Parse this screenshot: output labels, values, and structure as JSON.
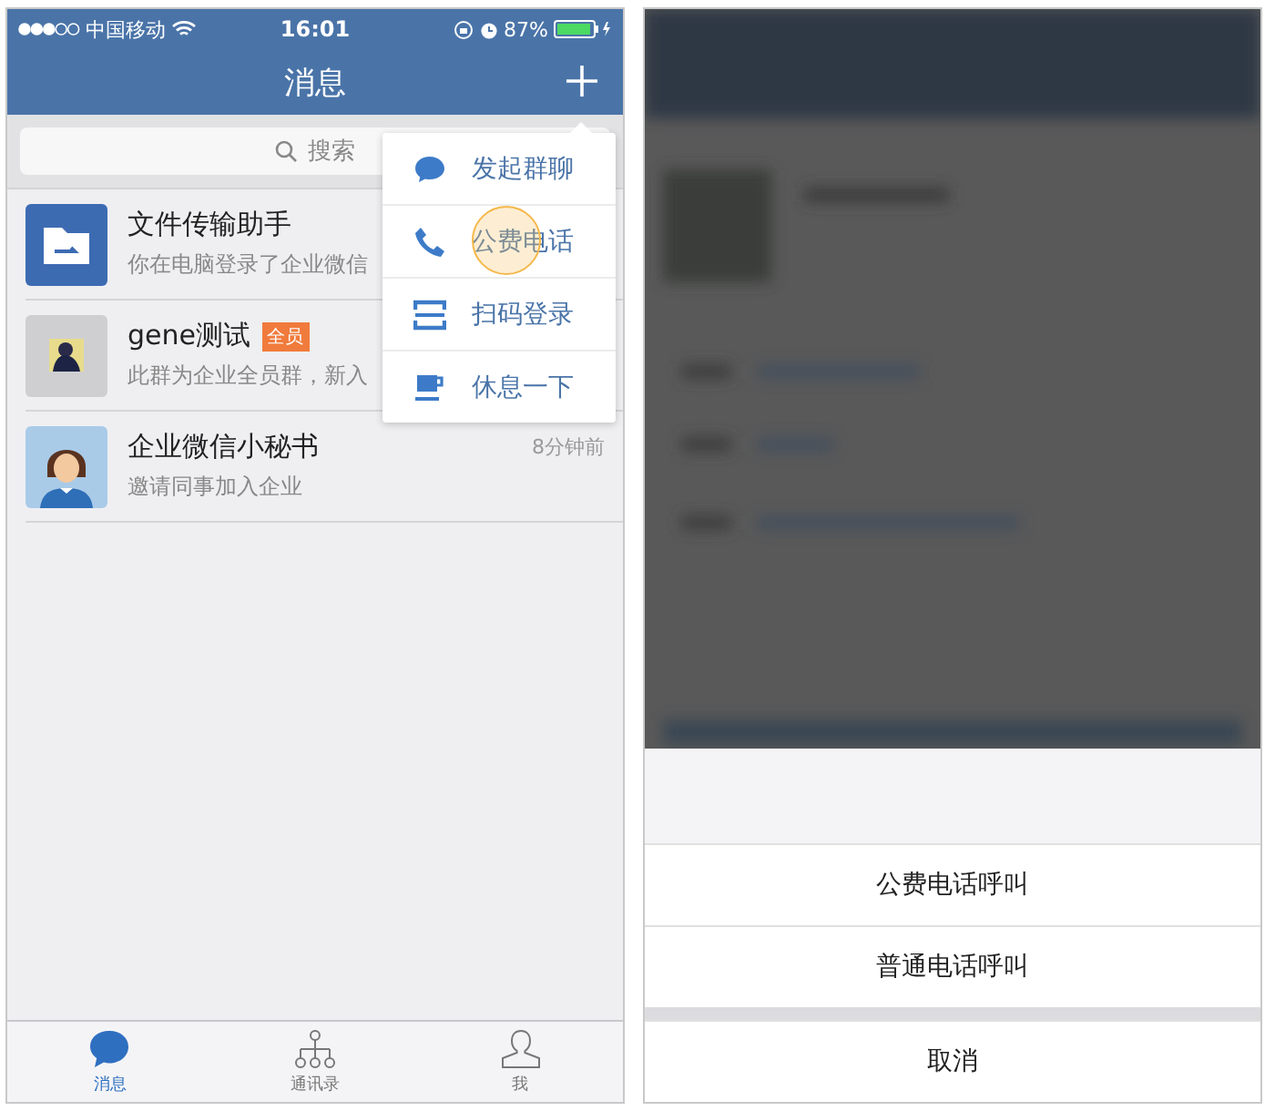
{
  "left_screen": {
    "status_bar": {
      "carrier": "中国移动",
      "time": "16:01",
      "battery": "87%"
    },
    "nav": {
      "title": "消息"
    },
    "search": {
      "placeholder": "搜索"
    },
    "chats": [
      {
        "kind": "file",
        "name": "文件传输助手",
        "preview": "你在电脑登录了企业微信"
      },
      {
        "kind": "group",
        "name": "gene测试",
        "tag": "全员",
        "preview": "此群为企业全员群，新入"
      },
      {
        "kind": "person",
        "name": "企业微信小秘书",
        "time": "8分钟前",
        "preview": "邀请同事加入企业"
      }
    ],
    "menu": [
      {
        "kind": "chat",
        "label": "发起群聊",
        "touched": false
      },
      {
        "kind": "phone",
        "label": "公费电话",
        "touched": true
      },
      {
        "kind": "scan",
        "label": "扫码登录",
        "touched": false
      },
      {
        "kind": "cup",
        "label": "休息一下",
        "touched": false
      }
    ],
    "tabs": [
      {
        "kind": "chat",
        "label": "消息",
        "selected": true
      },
      {
        "kind": "org",
        "label": "通讯录",
        "selected": false
      },
      {
        "kind": "me",
        "label": "我",
        "selected": false
      }
    ]
  },
  "right_screen": {
    "background": {
      "kind": "picture"
    },
    "sheet_options": [
      "公费电话呼叫",
      "普通电话呼叫"
    ],
    "cancel": "取消"
  }
}
